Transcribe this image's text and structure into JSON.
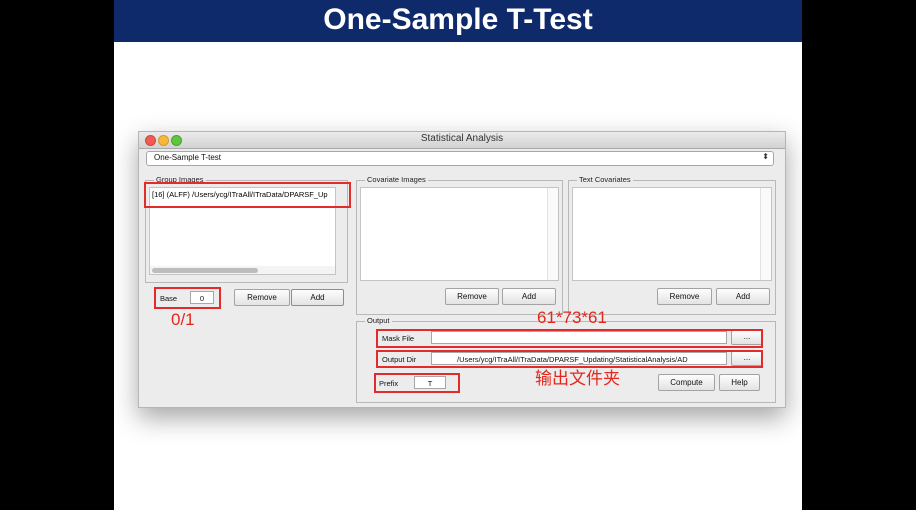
{
  "slide_title": "One-Sample T-Test",
  "window": {
    "title": "Statistical Analysis",
    "analysis_type": "One-Sample T-test"
  },
  "group_images": {
    "label": "Group Images",
    "items": [
      "[16] (ALFF) /Users/ycg/ITraAll/ITraData/DPARSF_Up"
    ],
    "base_label": "Base",
    "base_value": "0",
    "remove_label": "Remove",
    "add_label": "Add"
  },
  "covariate_images": {
    "label": "Covariate Images",
    "remove_label": "Remove",
    "add_label": "Add"
  },
  "text_covariates": {
    "label": "Text Covariates",
    "remove_label": "Remove",
    "add_label": "Add"
  },
  "output": {
    "label": "Output",
    "mask_file_label": "Mask File",
    "mask_file_value": "",
    "browse_label": "...",
    "output_dir_label": "Output Dir",
    "output_dir_value": "/Users/ycg/ITraAll/ITraData/DPARSF_Updating/StatisticalAnalysis/AD",
    "prefix_label": "Prefix",
    "prefix_value": "T",
    "compute_label": "Compute",
    "help_label": "Help"
  },
  "annotations": {
    "base_note": "0/1",
    "mask_note": "61*73*61",
    "output_note": "输出文件夹"
  },
  "colors": {
    "title_bar": "#0f2a6b",
    "highlight": "#e22b2b",
    "annotation": "#e5261c"
  }
}
